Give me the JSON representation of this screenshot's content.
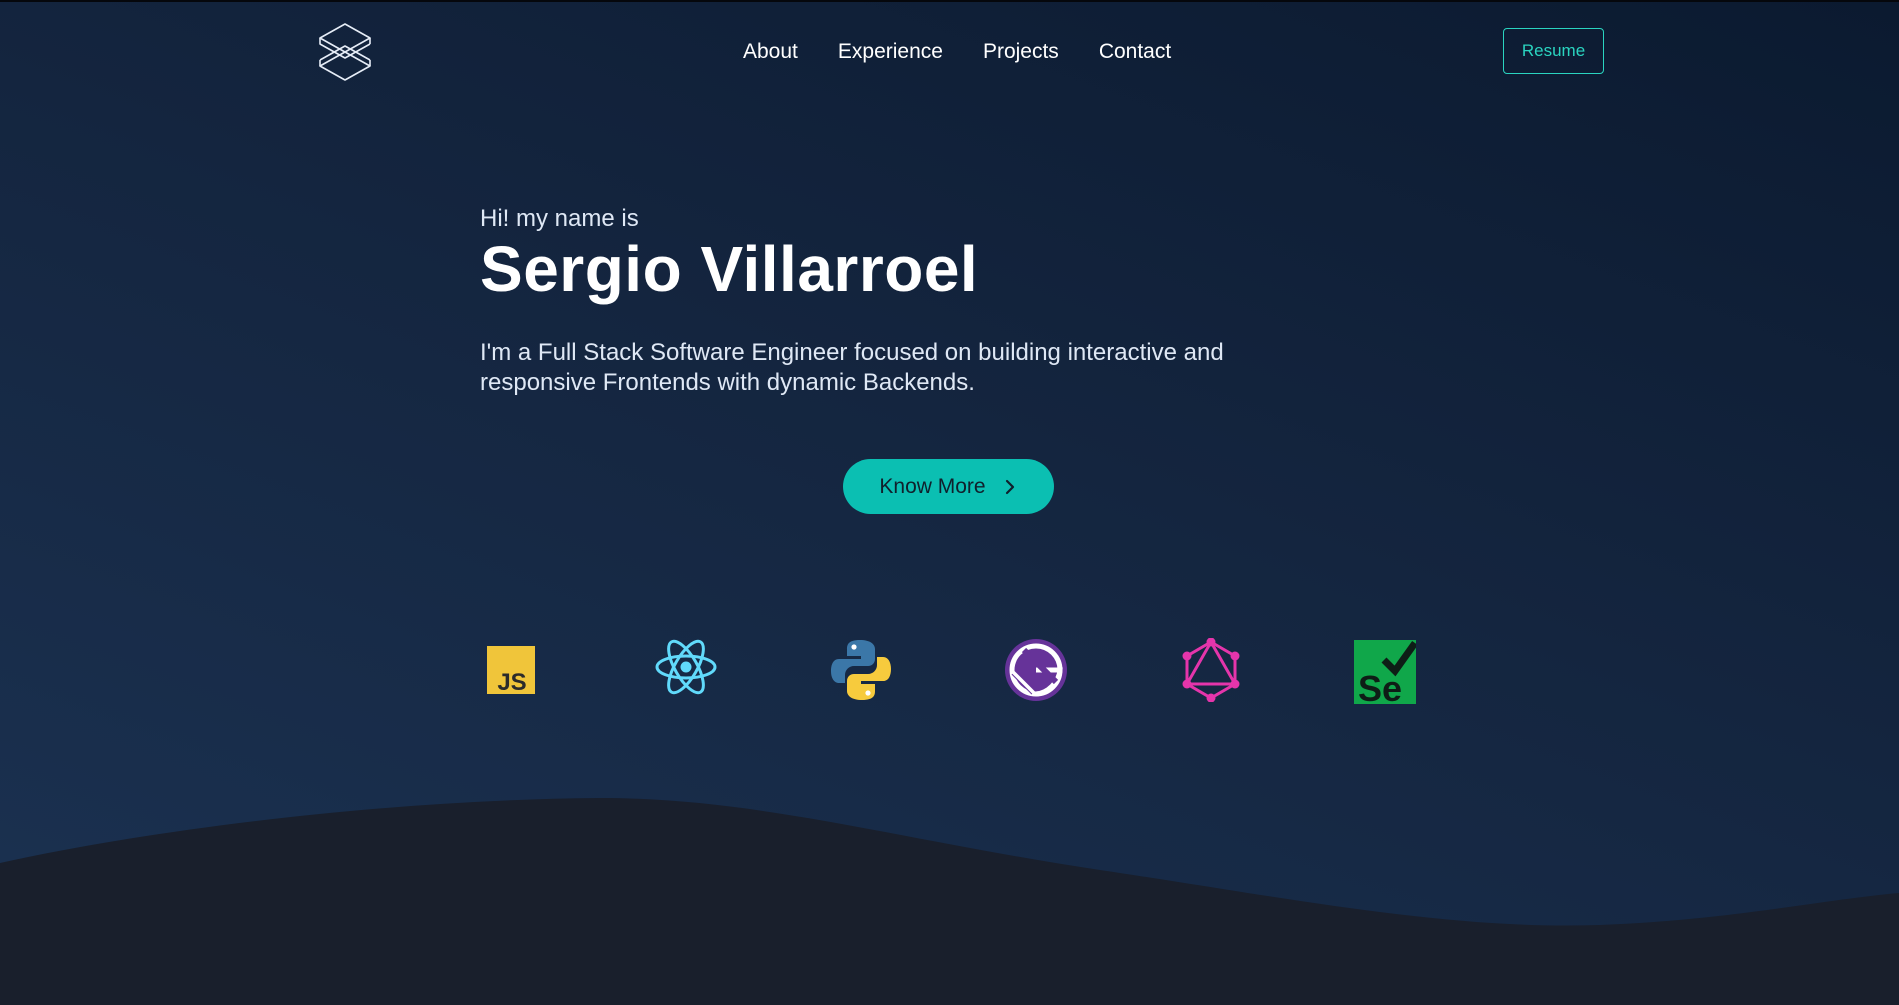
{
  "nav": {
    "links": [
      "About",
      "Experience",
      "Projects",
      "Contact"
    ],
    "resume_label": "Resume"
  },
  "hero": {
    "greeting": "Hi! my name is",
    "name": "Sergio Villarroel",
    "description": "I'm a Full Stack Software Engineer focused on building interactive and responsive Frontends with dynamic Backends.",
    "cta_label": "Know More"
  },
  "tech_icons": [
    "javascript-icon",
    "react-icon",
    "python-icon",
    "gatsby-icon",
    "graphql-icon",
    "selenium-icon"
  ],
  "colors": {
    "accent": "#2ad4c0",
    "cta_bg": "#0bbfb2",
    "background_top": "#0b1a30",
    "background_bottom": "#1b3252",
    "wave": "#191f2c"
  }
}
